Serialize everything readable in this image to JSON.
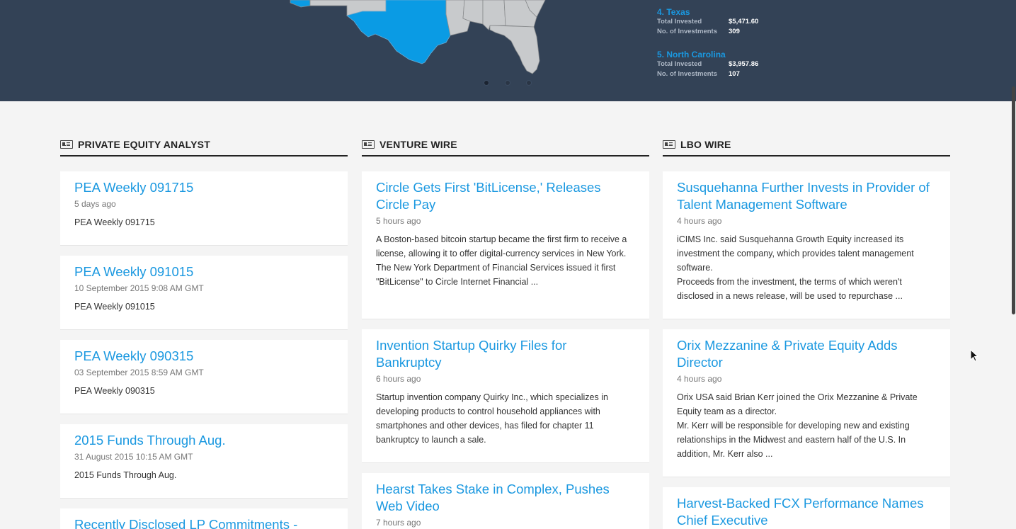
{
  "banner": {
    "rankings": [
      {
        "rank": "4.",
        "state": "Texas",
        "total_invested_label": "Total Invested",
        "total_invested": "$5,471.60",
        "num_investments_label": "No. of Investments",
        "num_investments": "309"
      },
      {
        "rank": "5.",
        "state": "North Carolina",
        "total_invested_label": "Total Invested",
        "total_invested": "$3,957.86",
        "num_investments_label": "No. of Investments",
        "num_investments": "107"
      }
    ],
    "map_colors": {
      "highlight": "#0a9be4",
      "land": "#c8cacc",
      "border": "#8a8c8e",
      "background": "#334256"
    },
    "carousel": {
      "slides": 3,
      "active": 1
    }
  },
  "columns": [
    {
      "icon": "newspaper-icon",
      "title": "PRIVATE EQUITY ANALYST",
      "articles": [
        {
          "headline": "PEA Weekly 091715",
          "time": "5 days ago",
          "summary": [
            "PEA Weekly 091715"
          ]
        },
        {
          "headline": "PEA Weekly 091015",
          "time": "10 September 2015 9:08 AM GMT",
          "summary": [
            "PEA Weekly 091015"
          ]
        },
        {
          "headline": "PEA Weekly 090315",
          "time": "03 September 2015 8:59 AM GMT",
          "summary": [
            "PEA Weekly 090315"
          ]
        },
        {
          "headline": "2015 Funds Through Aug.",
          "time": "31 August 2015 10:15 AM GMT",
          "summary": [
            "2015 Funds Through Aug."
          ]
        },
        {
          "headline": "Recently Disclosed LP Commitments -",
          "time": "",
          "summary": []
        }
      ]
    },
    {
      "icon": "newspaper-icon",
      "title": "VENTURE WIRE",
      "articles": [
        {
          "headline": "Circle Gets First 'BitLicense,' Releases Circle Pay",
          "time": "5 hours ago",
          "summary": [
            "A Boston-based bitcoin startup became the first firm to receive a license, allowing it to offer digital-currency services in New York.",
            "The New York Department of Financial Services issued it first \"BitLicense\" to Circle Internet Financial ..."
          ]
        },
        {
          "headline": "Invention Startup Quirky Files for Bankruptcy",
          "time": "6 hours ago",
          "summary": [
            "Startup invention company Quirky Inc., which specializes in developing products to control household appliances with smartphones and other devices, has filed for chapter 11 bankruptcy to launch a sale."
          ]
        },
        {
          "headline": "Hearst Takes Stake in Complex, Pushes Web Video",
          "time": "7 hours ago",
          "summary": []
        }
      ]
    },
    {
      "icon": "newspaper-icon",
      "title": "LBO WIRE",
      "articles": [
        {
          "headline": "Susquehanna Further Invests in Provider of Talent Management Software",
          "time": "4 hours ago",
          "summary": [
            "iCIMS Inc. said Susquehanna Growth Equity increased its investment the company, which provides talent management software.",
            "Proceeds from the investment, the terms of which weren't disclosed in a news release, will be used to repurchase ..."
          ]
        },
        {
          "headline": "Orix Mezzanine & Private Equity Adds Director",
          "time": "4 hours ago",
          "summary": [
            "Orix USA said Brian Kerr joined the Orix Mezzanine & Private Equity team as a director.",
            "Mr. Kerr will be responsible for developing new and existing relationships in the Midwest and eastern half of the U.S. In addition, Mr. Kerr also ..."
          ]
        },
        {
          "headline": "Harvest-Backed FCX Performance Names Chief Executive",
          "time": "",
          "summary": []
        }
      ]
    }
  ]
}
